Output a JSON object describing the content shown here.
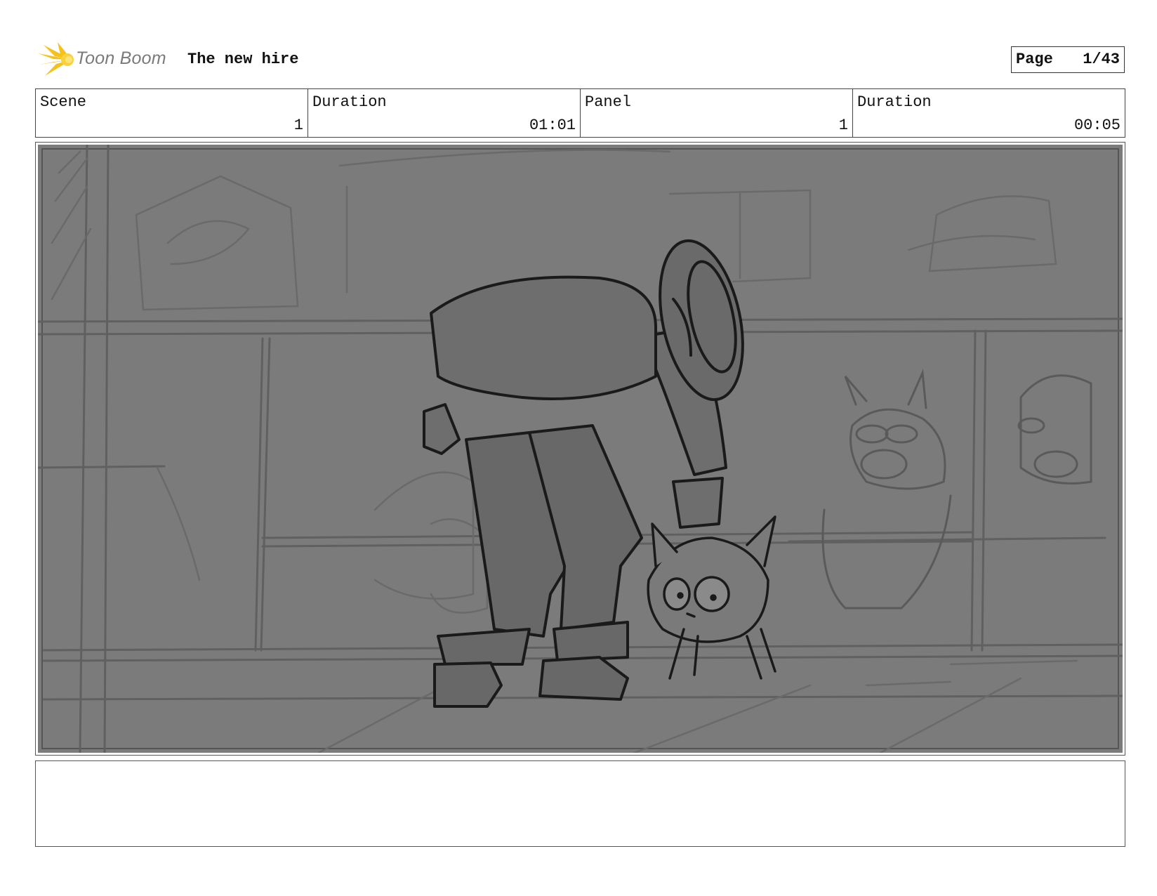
{
  "header": {
    "brand": "Toon Boom",
    "title": "The new hire",
    "page_label": "Page",
    "page_value": "1/43"
  },
  "info": [
    {
      "label": "Scene",
      "value": "1"
    },
    {
      "label": "Duration",
      "value": "01:01"
    },
    {
      "label": "Panel",
      "value": "1"
    },
    {
      "label": "Duration",
      "value": "00:05"
    }
  ],
  "panel": {
    "image": "storyboard-sketch-man-bending-to-pet-cat-in-shop"
  },
  "notes": {
    "text": ""
  },
  "colors": {
    "logo_accent": "#f5c21b",
    "panel_background": "#7b7b7b"
  }
}
